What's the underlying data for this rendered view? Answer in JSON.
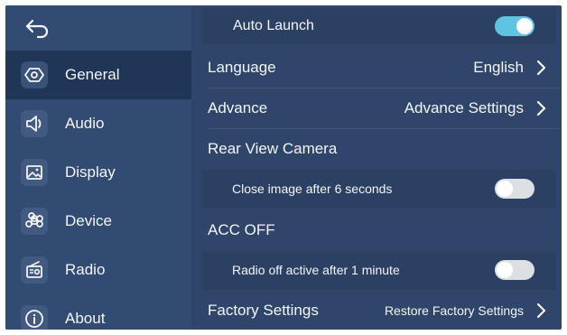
{
  "sidebar": {
    "items": [
      {
        "label": "General",
        "icon": "settings-hexagon-icon",
        "active": true
      },
      {
        "label": "Audio",
        "icon": "speaker-icon",
        "active": false
      },
      {
        "label": "Display",
        "icon": "image-icon",
        "active": false
      },
      {
        "label": "Device",
        "icon": "command-icon",
        "active": false
      },
      {
        "label": "Radio",
        "icon": "radio-icon",
        "active": false
      },
      {
        "label": "About",
        "icon": "info-icon",
        "active": false
      }
    ]
  },
  "settings": {
    "auto_launch": {
      "label": "Auto Launch",
      "enabled": true
    },
    "language": {
      "label": "Language",
      "value": "English"
    },
    "advance": {
      "label": "Advance",
      "value": "Advance Settings"
    },
    "rear_view_camera": {
      "label": "Rear View Camera",
      "option_label": "Close image after 6 seconds",
      "enabled": false
    },
    "acc_off": {
      "label": "ACC OFF",
      "option_label": "Radio off active after 1 minute",
      "enabled": false
    },
    "factory": {
      "label": "Factory Settings",
      "value": "Restore Factory Settings"
    }
  },
  "colors": {
    "background": "#2f4569",
    "sidebar": "#324b73",
    "sidebar_active": "#203657",
    "toggle_on": "#5fc4e0",
    "toggle_off": "#dcdfe3"
  }
}
